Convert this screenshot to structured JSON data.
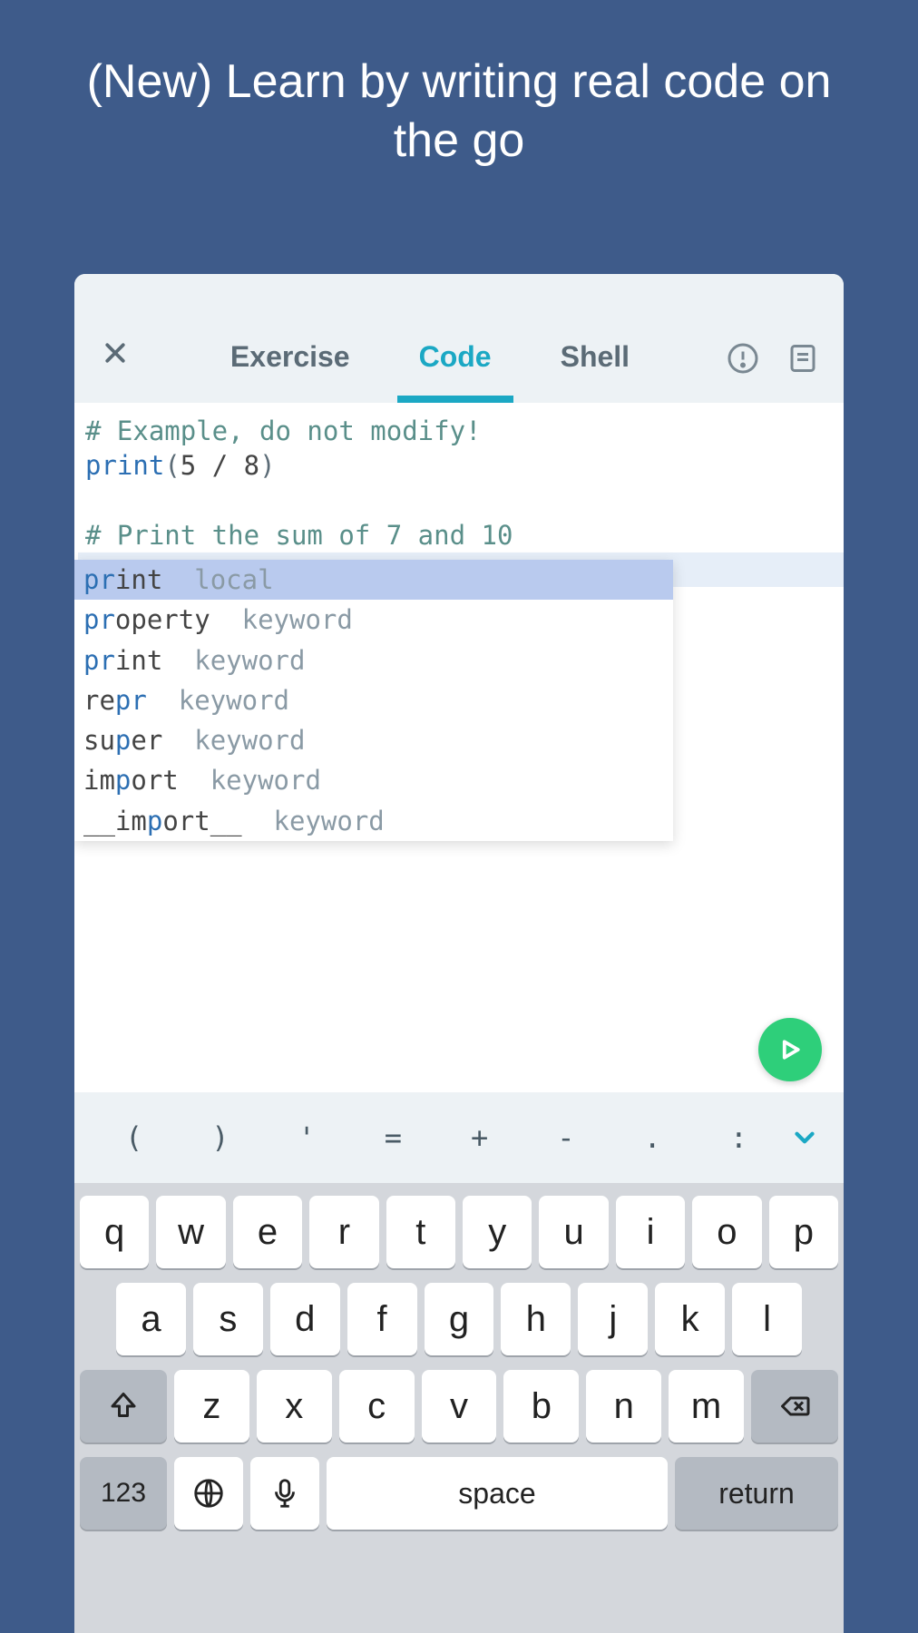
{
  "promo": {
    "title": "(New) Learn by writing real code on the go"
  },
  "tabs": {
    "exercise": "Exercise",
    "code": "Code",
    "shell": "Shell"
  },
  "code": {
    "comment1": "# Example, do not modify!",
    "func": "print",
    "open_paren": "(",
    "arg": "5 / 8",
    "close_paren": ")",
    "comment2": "# Print the sum of 7 and 10",
    "typed": "pr"
  },
  "autocomplete": [
    {
      "prefix": "pr",
      "rest": "int",
      "kind": "local"
    },
    {
      "prefix": "pr",
      "rest": "operty",
      "kind": "keyword"
    },
    {
      "prefix": "pr",
      "rest": "int",
      "kind": "keyword"
    },
    {
      "prefix": "re",
      "mid": "pr",
      "rest2": "",
      "kind": "keyword",
      "display_prefix": "re",
      "display_match": "pr"
    },
    {
      "prefix": "su",
      "mid": "p",
      "rest2": "er",
      "kind": "keyword"
    },
    {
      "prefix": "im",
      "mid": "p",
      "rest2": "ort",
      "kind": "keyword"
    },
    {
      "prefix": "__im",
      "mid": "p",
      "rest2": "ort__",
      "kind": "keyword"
    }
  ],
  "symbols": [
    "(",
    ")",
    "'",
    "=",
    "+",
    "-",
    ".",
    ":"
  ],
  "keyboard": {
    "row1": [
      "q",
      "w",
      "e",
      "r",
      "t",
      "y",
      "u",
      "i",
      "o",
      "p"
    ],
    "row2": [
      "a",
      "s",
      "d",
      "f",
      "g",
      "h",
      "j",
      "k",
      "l"
    ],
    "row3": [
      "z",
      "x",
      "c",
      "v",
      "b",
      "n",
      "m"
    ],
    "numKey": "123",
    "space": "space",
    "return": "return"
  }
}
